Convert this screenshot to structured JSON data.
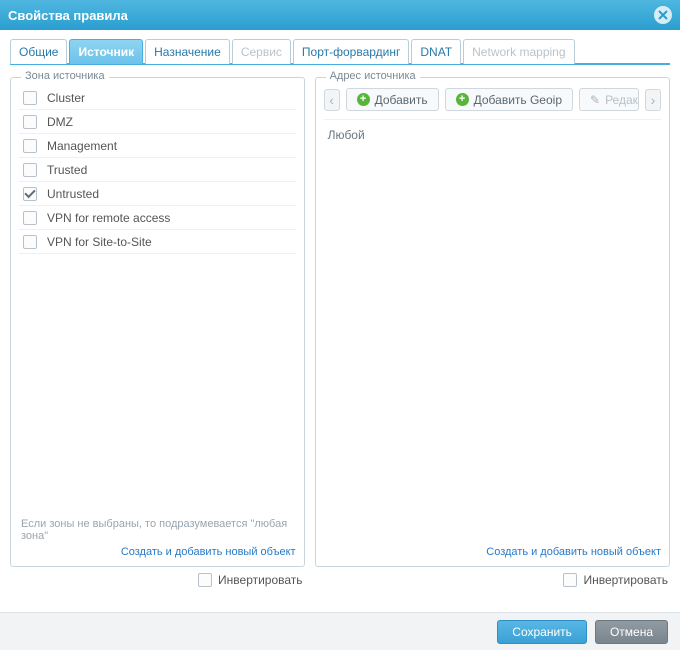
{
  "window": {
    "title": "Свойства правила"
  },
  "tabs": [
    {
      "label": "Общие",
      "state": "normal"
    },
    {
      "label": "Источник",
      "state": "active"
    },
    {
      "label": "Назначение",
      "state": "normal"
    },
    {
      "label": "Сервис",
      "state": "disabled"
    },
    {
      "label": "Порт-форвардинг",
      "state": "normal"
    },
    {
      "label": "DNAT",
      "state": "normal"
    },
    {
      "label": "Network mapping",
      "state": "disabled"
    }
  ],
  "zonePanel": {
    "legend": "Зона источника",
    "zones": [
      {
        "name": "Cluster",
        "checked": false
      },
      {
        "name": "DMZ",
        "checked": false
      },
      {
        "name": "Management",
        "checked": false
      },
      {
        "name": "Trusted",
        "checked": false
      },
      {
        "name": "Untrusted",
        "checked": true
      },
      {
        "name": "VPN for remote access",
        "checked": false
      },
      {
        "name": "VPN for Site-to-Site",
        "checked": false
      }
    ],
    "hint": "Если зоны не выбраны, то подразумевается \"любая зона\"",
    "createLink": "Создать и добавить новый объект",
    "invertLabel": "Инвертировать",
    "invertChecked": false
  },
  "addressPanel": {
    "legend": "Адрес источника",
    "buttons": {
      "add": "Добавить",
      "addGeoip": "Добавить Geoip",
      "edit": "Редактировать"
    },
    "emptyText": "Любой",
    "createLink": "Создать и добавить новый объект",
    "invertLabel": "Инвертировать",
    "invertChecked": false
  },
  "footer": {
    "save": "Сохранить",
    "cancel": "Отмена"
  }
}
